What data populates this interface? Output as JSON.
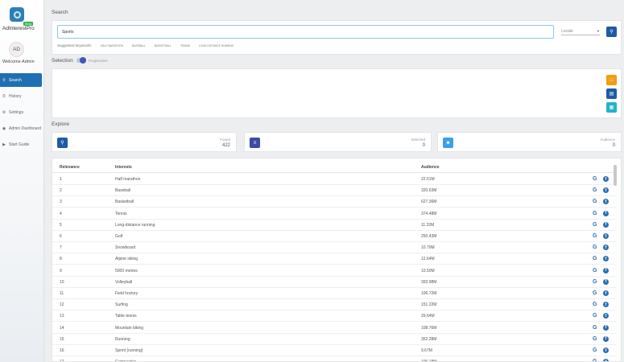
{
  "app": {
    "name": "AdInterestPro",
    "badge": "Beta",
    "welcome": "Welcome Admin",
    "avatar_initials": "AD"
  },
  "nav": [
    {
      "label": "Search",
      "icon": "search-icon",
      "active": true
    },
    {
      "label": "History",
      "icon": "history-icon",
      "active": false
    },
    {
      "label": "Settings",
      "icon": "gear-icon",
      "active": false
    },
    {
      "label": "Admin Dashboard",
      "icon": "dashboard-icon",
      "active": false
    },
    {
      "label": "Start Guide",
      "icon": "guide-icon",
      "active": false
    }
  ],
  "search": {
    "section_label": "Search",
    "value": "Sports",
    "locale_placeholder": "Locale",
    "suggested_label": "Suggested keywords:",
    "suggested": [
      "Half marathon",
      "Baseball",
      "Basketball",
      "Tennis",
      "Long-distance running"
    ]
  },
  "selection": {
    "section_label": "Selection",
    "toggle_label": "Progressive"
  },
  "explore": {
    "section_label": "Explore",
    "found_label": "Found",
    "found_value": "422",
    "selected_label": "Selected",
    "selected_value": "0",
    "audience_label": "Audience",
    "audience_value": "0"
  },
  "table": {
    "headers": {
      "relevance": "Relevance",
      "interests": "Interests",
      "audience": "Audience"
    },
    "rows": [
      {
        "rel": "1",
        "name": "Half marathon",
        "aud": "22.51M"
      },
      {
        "rel": "2",
        "name": "Baseball",
        "aud": "320.63M"
      },
      {
        "rel": "3",
        "name": "Basketball",
        "aud": "627.36M"
      },
      {
        "rel": "4",
        "name": "Tennis",
        "aud": "374.48M"
      },
      {
        "rel": "5",
        "name": "Long-distance running",
        "aud": "11.32M"
      },
      {
        "rel": "6",
        "name": "Golf",
        "aud": "250.43M"
      },
      {
        "rel": "7",
        "name": "Snowboard",
        "aud": "10.79M"
      },
      {
        "rel": "8",
        "name": "Alpine skiing",
        "aud": "12.64M"
      },
      {
        "rel": "9",
        "name": "5000 metres",
        "aud": "10.50M"
      },
      {
        "rel": "10",
        "name": "Volleyball",
        "aud": "393.98M"
      },
      {
        "rel": "11",
        "name": "Field hockey",
        "aud": "106.72M"
      },
      {
        "rel": "12",
        "name": "Surfing",
        "aud": "151.22M"
      },
      {
        "rel": "13",
        "name": "Table tennis",
        "aud": "29.64M"
      },
      {
        "rel": "14",
        "name": "Mountain biking",
        "aud": "108.76M"
      },
      {
        "rel": "15",
        "name": "Running",
        "aud": "352.28M"
      },
      {
        "rel": "16",
        "name": "Sprint (running)",
        "aud": "9.67M"
      },
      {
        "rel": "17",
        "name": "Gymnastics",
        "aud": "106.18M"
      }
    ]
  },
  "colors": {
    "primary": "#1f5aa6",
    "orange": "#f39c12",
    "teal": "#1fb5c9",
    "indigo": "#3d4aa8",
    "light_blue": "#3aa0e8"
  }
}
